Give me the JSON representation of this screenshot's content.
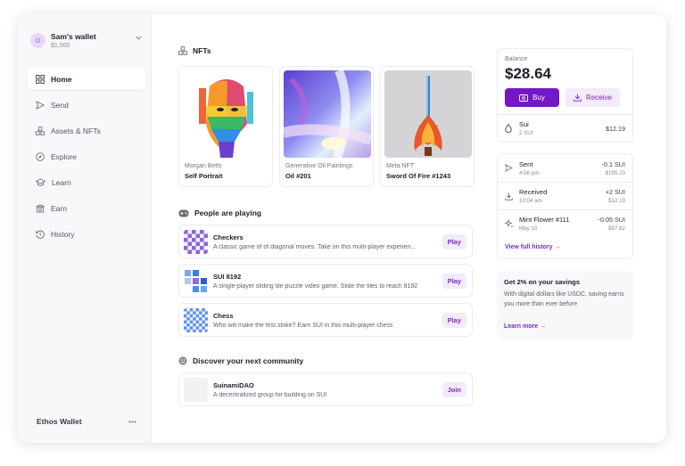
{
  "wallet": {
    "name": "Sam's wallet",
    "amount": "$1,000",
    "avatar_glyph": "☺"
  },
  "sidebar": {
    "items": [
      {
        "label": "Home",
        "icon": "home-icon",
        "active": true
      },
      {
        "label": "Send",
        "icon": "send-icon"
      },
      {
        "label": "Assets & NFTs",
        "icon": "assets-icon"
      },
      {
        "label": "Explore",
        "icon": "compass-icon"
      },
      {
        "label": "Learn",
        "icon": "graduation-cap-icon"
      },
      {
        "label": "Earn",
        "icon": "bank-icon"
      },
      {
        "label": "History",
        "icon": "history-icon"
      }
    ],
    "footer_label": "Ethos Wallet",
    "footer_more": "•••"
  },
  "nfts": {
    "title": "NFTs",
    "items": [
      {
        "collection": "Morgan Betts",
        "name": "Self Portrait"
      },
      {
        "collection": "Generative Oil Paintings",
        "name": "Oil #201"
      },
      {
        "collection": "Meta NFT",
        "name": "Sword Of Fire #1243"
      }
    ]
  },
  "games": {
    "title": "People are playing",
    "action": "Play",
    "items": [
      {
        "name": "Checkers",
        "description": "A classic game of of diagonal moves. Take on this multi-player experien..."
      },
      {
        "name": "SUI 8192",
        "description": "A single-player sliding tile puzzle video game. Slide the tiles to reach 8192"
      },
      {
        "name": "Chess",
        "description": "Who will make the first strike? Earn SUI in this multi-player chess"
      }
    ]
  },
  "community": {
    "title": "Discover your next community",
    "action": "Join",
    "items": [
      {
        "name": "SuinamiDAO",
        "description": "A decentralized group for building on SUI"
      }
    ]
  },
  "balance": {
    "label": "Balance",
    "value": "$28.64",
    "buy_label": "Buy",
    "receive_label": "Receive",
    "token": {
      "name": "Sui",
      "amount": "2 SUI",
      "usd": "$12.19"
    }
  },
  "activity": {
    "items": [
      {
        "name": "Sent",
        "time": "4:56 pm",
        "amount": "-0.1 SUI",
        "usd": "$195.23",
        "icon": "send-icon"
      },
      {
        "name": "Received",
        "time": "10:04 am",
        "amount": "+2 SUI",
        "usd": "$12.19",
        "icon": "download-icon"
      },
      {
        "name": "Mint Flower #111",
        "time": "May 10",
        "amount": "-0.05 SUI",
        "usd": "$97.62",
        "icon": "sparkle-icon"
      }
    ],
    "view_all": "View full history →"
  },
  "promo": {
    "title": "Get 2% on your savings",
    "body": "With digital dollars like USDC, saving earns you more than ever before",
    "link": "Learn more →"
  },
  "colors": {
    "accent": "#7317c7",
    "accent_soft": "#f3eafb",
    "sidebar_bg": "#f8f8fa"
  }
}
